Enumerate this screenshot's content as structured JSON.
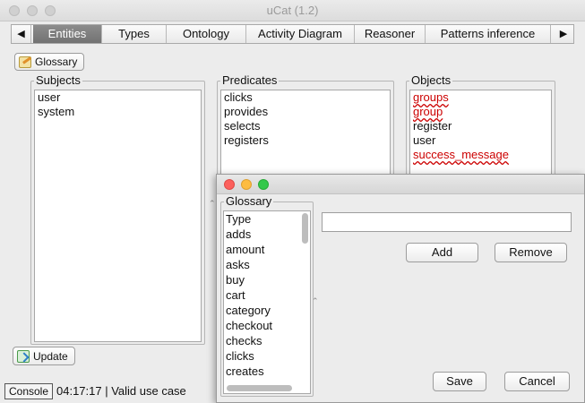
{
  "window": {
    "title": "uCat (1.2)"
  },
  "tabs": {
    "left_arrow": "◀",
    "right_arrow": "▶",
    "items": [
      {
        "label": "Entities",
        "active": true
      },
      {
        "label": "Types",
        "active": false
      },
      {
        "label": "Ontology",
        "active": false
      },
      {
        "label": "Activity Diagram",
        "active": false
      },
      {
        "label": "Reasoner",
        "active": false
      },
      {
        "label": "Patterns inference",
        "active": false
      }
    ]
  },
  "toolbar": {
    "glossary_label": "Glossary",
    "glossary_icon": "edit-icon"
  },
  "panels": {
    "subjects": {
      "title": "Subjects",
      "items": [
        "user",
        "system"
      ]
    },
    "predicates": {
      "title": "Predicates",
      "items": [
        "clicks",
        "provides",
        "selects",
        "registers"
      ]
    },
    "objects": {
      "title": "Objects",
      "items": [
        {
          "text": "groups",
          "error": true
        },
        {
          "text": "group",
          "error": true
        },
        {
          "text": "register",
          "error": false
        },
        {
          "text": "user",
          "error": false
        },
        {
          "text": "success_message",
          "error": true
        }
      ]
    }
  },
  "footer": {
    "update_label": "Update",
    "update_icon": "refresh-icon",
    "console_label": "Console",
    "status_text": "04:17:17 | Valid use case"
  },
  "glossary_dialog": {
    "group_title": "Glossary",
    "items": [
      "Type",
      "adds",
      "amount",
      "asks",
      "buy",
      "cart",
      "category",
      "checkout",
      "checks",
      "clicks",
      "creates"
    ],
    "input_value": "",
    "add_label": "Add",
    "remove_label": "Remove",
    "save_label": "Save",
    "cancel_label": "Cancel"
  },
  "colors": {
    "error_text": "#cc0000",
    "close_button": "#fc605c",
    "minimize_button": "#fdbc40",
    "zoom_button": "#34c84a",
    "active_tab": "#808080"
  }
}
